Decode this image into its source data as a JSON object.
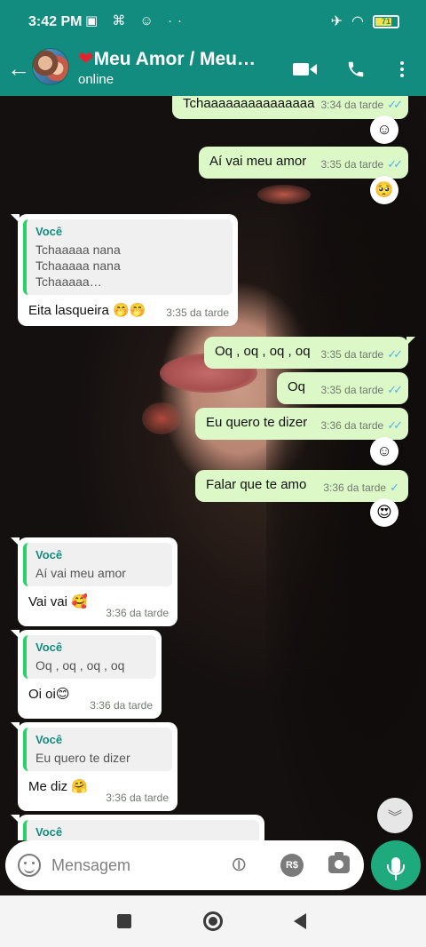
{
  "status_bar": {
    "time": "3:42 PM",
    "left_icons": "▣ ⌘ ☺ ··",
    "battery": "71"
  },
  "header": {
    "contact_name": "Meu Amor / Meu…",
    "heart": "❤",
    "status": "online"
  },
  "messages": [
    {
      "dir": "out",
      "text": "Tchaaaaaaaaaaaaaaa",
      "time": "3:34 da tarde",
      "ticks": "✓✓",
      "reaction": "☺"
    },
    {
      "dir": "out",
      "text": "Aí vai meu amor",
      "time": "3:35 da tarde",
      "ticks": "✓✓",
      "reaction": "🥺"
    },
    {
      "dir": "in",
      "quote_author": "Você",
      "quote_text": "Tchaaaaa nana\nTchaaaaa nana\nTchaaaaa…",
      "text": "Eita lasqueira 🤭🤭",
      "time": "3:35 da tarde"
    },
    {
      "dir": "out",
      "text": "Oq , oq , oq , oq",
      "time": "3:35 da tarde",
      "ticks": "✓✓"
    },
    {
      "dir": "out",
      "text": "Oq",
      "time": "3:35 da tarde",
      "ticks": "✓✓"
    },
    {
      "dir": "out",
      "text": "Eu quero te dizer",
      "time": "3:36 da tarde",
      "ticks": "✓✓",
      "reaction": "☺"
    },
    {
      "dir": "out",
      "text": "Falar que te amo",
      "time": "3:36 da tarde",
      "ticks": "✓",
      "reaction": "😍"
    },
    {
      "dir": "in",
      "quote_author": "Você",
      "quote_text": "Aí vai meu amor",
      "text": "Vai vai 🥰",
      "time": "3:36 da tarde"
    },
    {
      "dir": "in",
      "quote_author": "Você",
      "quote_text": "Oq , oq , oq , oq",
      "text": "Oi oi😊",
      "time": "3:36 da tarde"
    },
    {
      "dir": "in",
      "quote_author": "Você",
      "quote_text": "Eu quero te dizer",
      "text": "Me diz 🤗",
      "time": "3:36 da tarde"
    },
    {
      "dir": "in",
      "quote_author": "Você"
    }
  ],
  "composer": {
    "placeholder": "Mensagem",
    "pay_label": "R$"
  },
  "scroll_down_icon": "︾",
  "colors": {
    "header_bg": "#128c7e",
    "outgoing_bubble": "#dcf8c6",
    "incoming_bubble": "#ffffff",
    "read_tick": "#4fb6ec",
    "mic_button": "#1faa7e"
  }
}
